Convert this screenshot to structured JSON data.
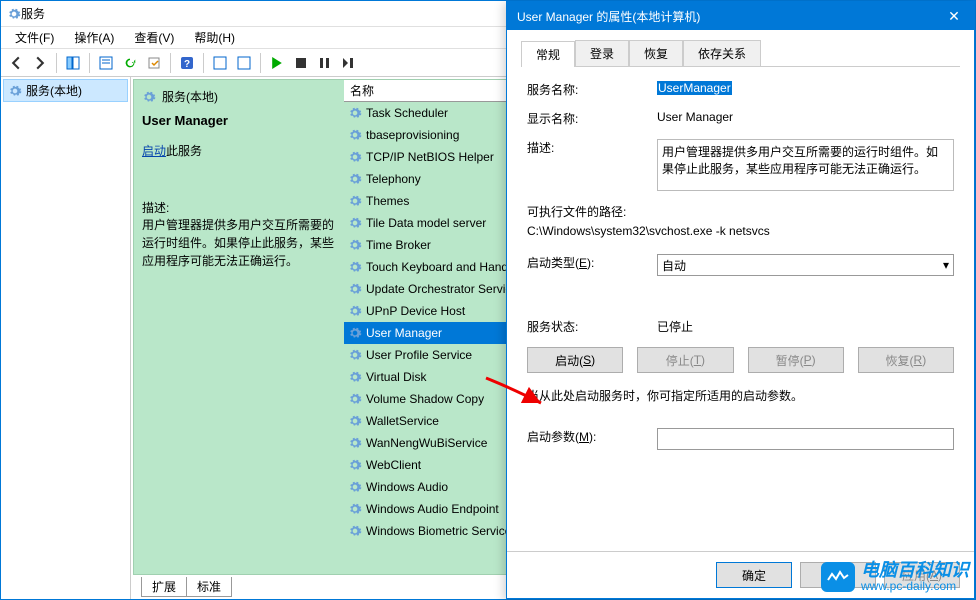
{
  "window": {
    "title": "服务"
  },
  "menubar": {
    "file": "文件(F)",
    "action": "操作(A)",
    "view": "查看(V)",
    "help": "帮助(H)"
  },
  "tree": {
    "root": "服务(本地)"
  },
  "center": {
    "heading": "服务(本地)",
    "serviceName": "User Manager",
    "startLinkPrefix": "启动",
    "startLinkSuffix": "此服务",
    "descLabel": "描述:",
    "description": "用户管理器提供多用户交互所需要的运行时组件。如果停止此服务，某些应用程序可能无法正确运行。",
    "listHeader": "名称",
    "items": [
      "Task Scheduler",
      "tbaseprovisioning",
      "TCP/IP NetBIOS Helper",
      "Telephony",
      "Themes",
      "Tile Data model server",
      "Time Broker",
      "Touch Keyboard and Handwriting",
      "Update Orchestrator Service",
      "UPnP Device Host",
      "User Manager",
      "User Profile Service",
      "Virtual Disk",
      "Volume Shadow Copy",
      "WalletService",
      "WanNengWuBiService",
      "WebClient",
      "Windows Audio",
      "Windows Audio Endpoint",
      "Windows Biometric Service"
    ],
    "selectedIndex": 10,
    "tabs": {
      "extended": "扩展",
      "standard": "标准"
    }
  },
  "dialog": {
    "title": "User Manager 的属性(本地计算机)",
    "tabs": {
      "general": "常规",
      "logon": "登录",
      "recovery": "恢复",
      "dependencies": "依存关系"
    },
    "labels": {
      "serviceName": "服务名称:",
      "displayName": "显示名称:",
      "description": "描述:",
      "exePath": "可执行文件的路径:",
      "startupType": "启动类型(E):",
      "serviceStatus": "服务状态:",
      "startHint": "当从此处启动服务时，你可指定所适用的启动参数。",
      "startParams": "启动参数(M):"
    },
    "values": {
      "serviceName": "UserManager",
      "displayName": "User Manager",
      "description": "用户管理器提供多用户交互所需要的运行时组件。如果停止此服务，某些应用程序可能无法正确运行。",
      "exePath": "C:\\Windows\\system32\\svchost.exe -k netsvcs",
      "startupType": "自动",
      "serviceStatus": "已停止"
    },
    "buttons": {
      "start": "启动(S)",
      "stop": "停止(T)",
      "pause": "暂停(P)",
      "resume": "恢复(R)",
      "ok": "确定",
      "cancel": "取消",
      "apply": "应用(A)"
    }
  },
  "watermark": {
    "brand": "电脑百科知识",
    "url": "www.pc-daily.com"
  }
}
